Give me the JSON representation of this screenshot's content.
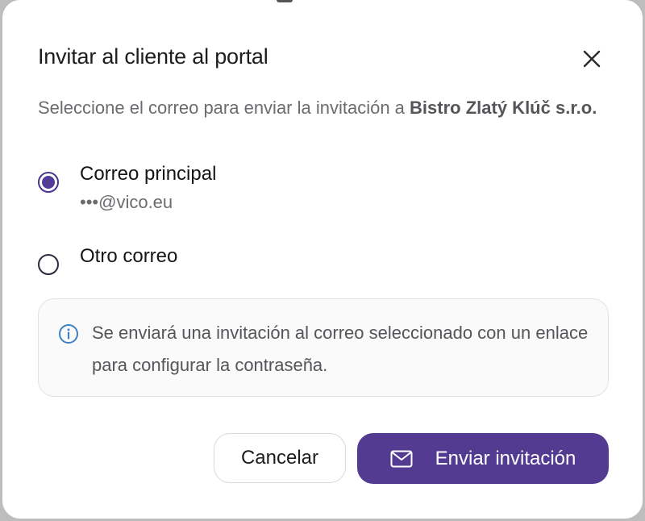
{
  "dialog": {
    "title": "Invitar al cliente al portal",
    "close_icon": "close-icon",
    "description_prefix": "Seleccione el correo para enviar la invitación a ",
    "client_name": "Bistro Zlatý Klúč s.r.o.",
    "description_suffix": ""
  },
  "options": [
    {
      "label": "Correo principal",
      "sub": "•••@vico.eu",
      "selected": true
    },
    {
      "label": "Otro correo",
      "selected": false
    }
  ],
  "info": {
    "icon": "info-icon",
    "text": "Se enviará una invitación al correo seleccionado con un enlace para configurar la contraseña."
  },
  "actions": {
    "cancel_label": "Cancelar",
    "send_label": "Enviar invitación",
    "send_icon": "mail-icon"
  },
  "colors": {
    "accent": "#533b91",
    "radio_selected": "#523c96"
  }
}
